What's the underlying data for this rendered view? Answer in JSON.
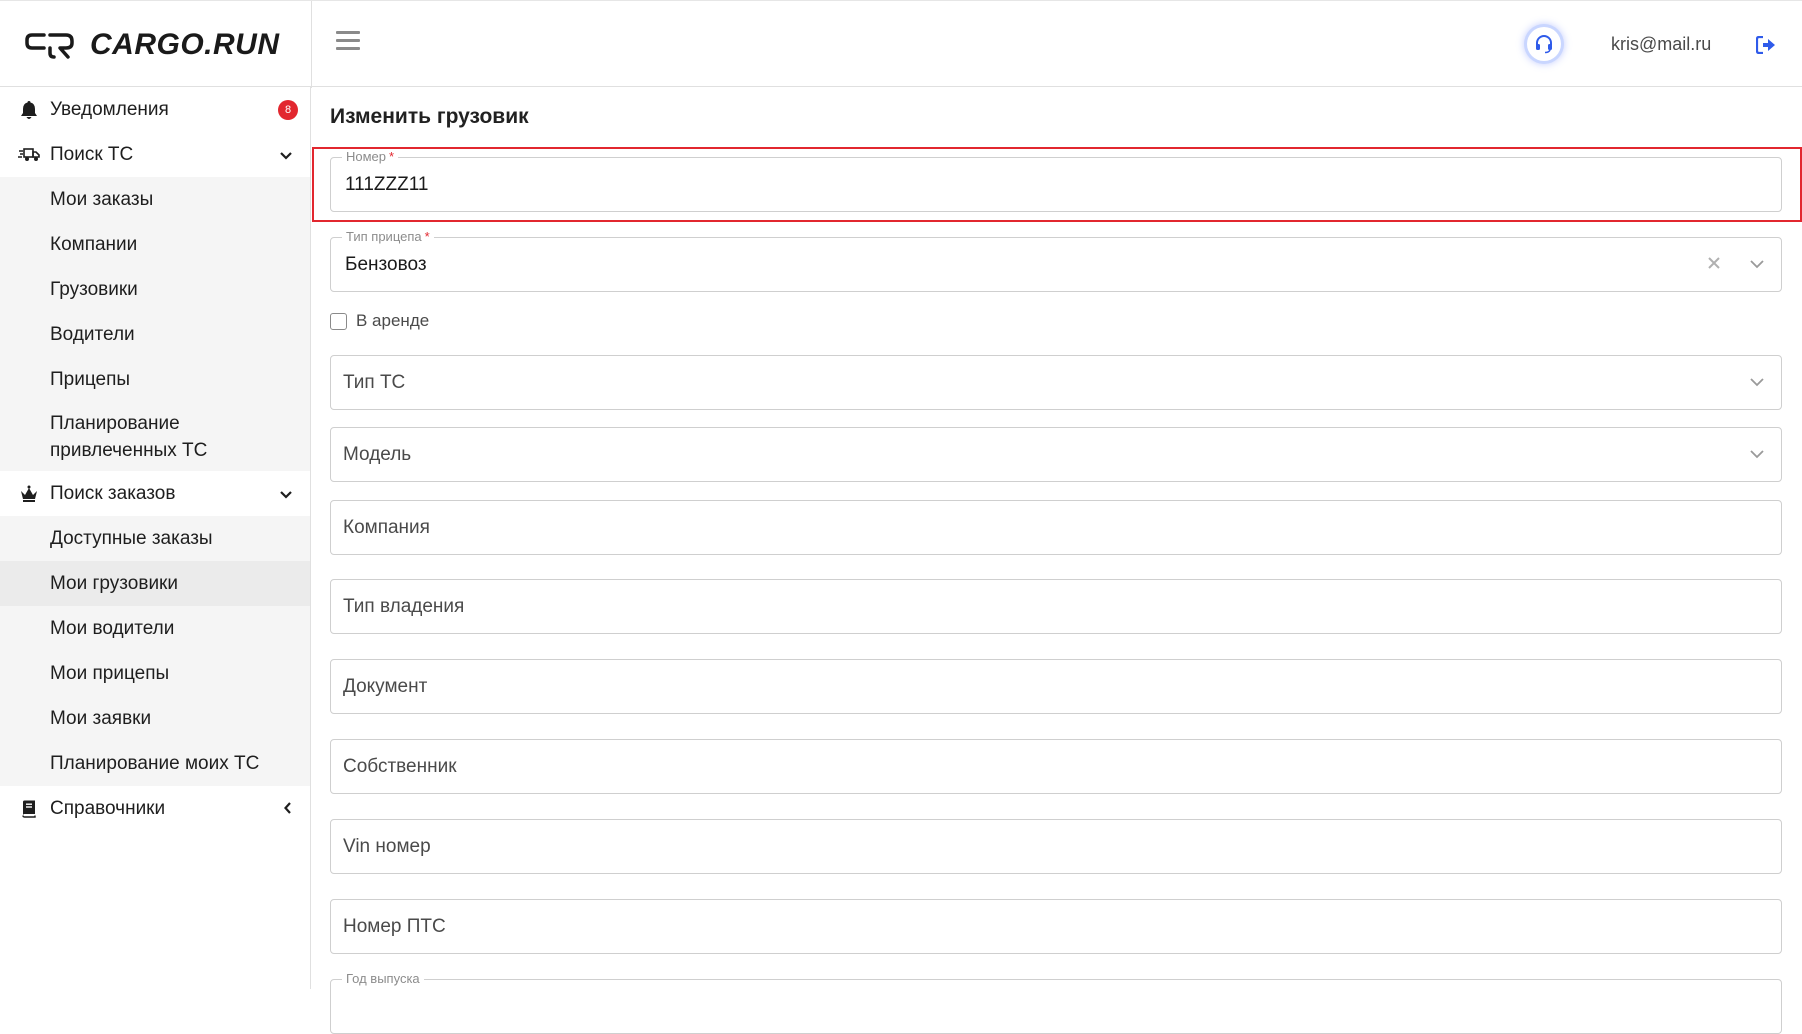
{
  "header": {
    "logo_text": "CARGO.RUN",
    "user_email": "kris@mail.ru",
    "icons": [
      "menu-icon",
      "headset-icon",
      "logout-icon"
    ],
    "accent_color": "#2f5bea"
  },
  "sidebar": {
    "notifications": {
      "label": "Уведомления",
      "count": "8"
    },
    "search_vehicles": {
      "label": "Поиск ТС",
      "items": [
        "Мои заказы",
        "Компании",
        "Грузовики",
        "Водители",
        "Прицепы",
        "Планирование привлеченных ТС"
      ]
    },
    "search_orders": {
      "label": "Поиск заказов",
      "items": [
        "Доступные заказы",
        "Мои грузовики",
        "Мои водители",
        "Мои прицепы",
        "Мои заявки",
        "Планирование моих ТС"
      ],
      "active_item": "Мои грузовики"
    },
    "references": {
      "label": "Справочники"
    }
  },
  "main": {
    "title": "Изменить грузовик",
    "fields": {
      "number": {
        "label": "Номер",
        "required_mark": "*",
        "value": "111ZZZ11"
      },
      "trailer_type": {
        "label": "Тип прицепа",
        "required_mark": "*",
        "value": "Бензовоз"
      },
      "rent_checkbox": {
        "label": "В аренде",
        "checked": false
      },
      "vehicle_type": {
        "placeholder": "Тип ТС"
      },
      "model": {
        "placeholder": "Модель"
      },
      "company": {
        "placeholder": "Компания"
      },
      "ownership_type": {
        "placeholder": "Тип владения"
      },
      "document": {
        "placeholder": "Документ"
      },
      "owner": {
        "placeholder": "Собственник"
      },
      "vin": {
        "placeholder": "Vin номер"
      },
      "pts_number": {
        "placeholder": "Номер ПТС"
      },
      "year": {
        "label": "Год выпуска"
      }
    }
  }
}
